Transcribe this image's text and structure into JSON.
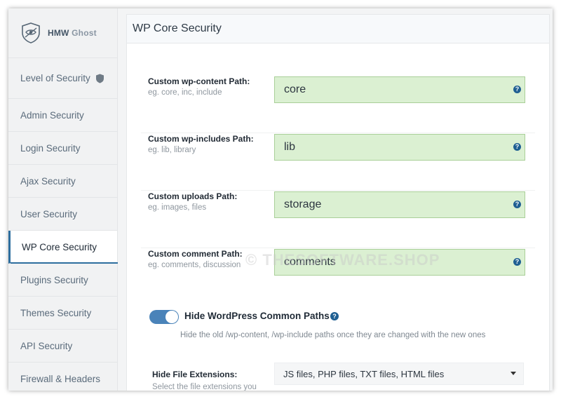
{
  "brand": {
    "name_main": "HMW",
    "name_sub": "Ghost"
  },
  "sidebar": {
    "items": [
      {
        "label": "Level of Security"
      },
      {
        "label": "Admin Security"
      },
      {
        "label": "Login Security"
      },
      {
        "label": "Ajax Security"
      },
      {
        "label": "User Security"
      },
      {
        "label": "WP Core Security"
      },
      {
        "label": "Plugins Security"
      },
      {
        "label": "Themes Security"
      },
      {
        "label": "API Security"
      },
      {
        "label": "Firewall & Headers"
      }
    ],
    "active_index": 5
  },
  "main": {
    "title": "WP Core Security",
    "fields": [
      {
        "label": "Custom wp-content Path:",
        "hint": "eg. core, inc, include",
        "value": "core"
      },
      {
        "label": "Custom wp-includes Path:",
        "hint": "eg. lib, library",
        "value": "lib"
      },
      {
        "label": "Custom uploads Path:",
        "hint": "eg. images, files",
        "value": "storage"
      },
      {
        "label": "Custom comment Path:",
        "hint": "eg. comments, discussion",
        "value": "comments"
      }
    ],
    "toggle": {
      "label": "Hide WordPress Common Paths",
      "description": "Hide the old /wp-content, /wp-include paths once they are changed with the new ones",
      "on": true
    },
    "extensions": {
      "label": "Hide File Extensions:",
      "hint": "Select the file extensions you",
      "selected": "JS files, PHP files, TXT files, HTML files"
    }
  },
  "help_glyph": "?",
  "watermark": "© THESOFTWARE.SHOP",
  "colors": {
    "accent": "#2d6e9e",
    "field_bg": "#dbf0d2",
    "toggle_on": "#4a83b9",
    "help_icon": "#1f5f92"
  }
}
